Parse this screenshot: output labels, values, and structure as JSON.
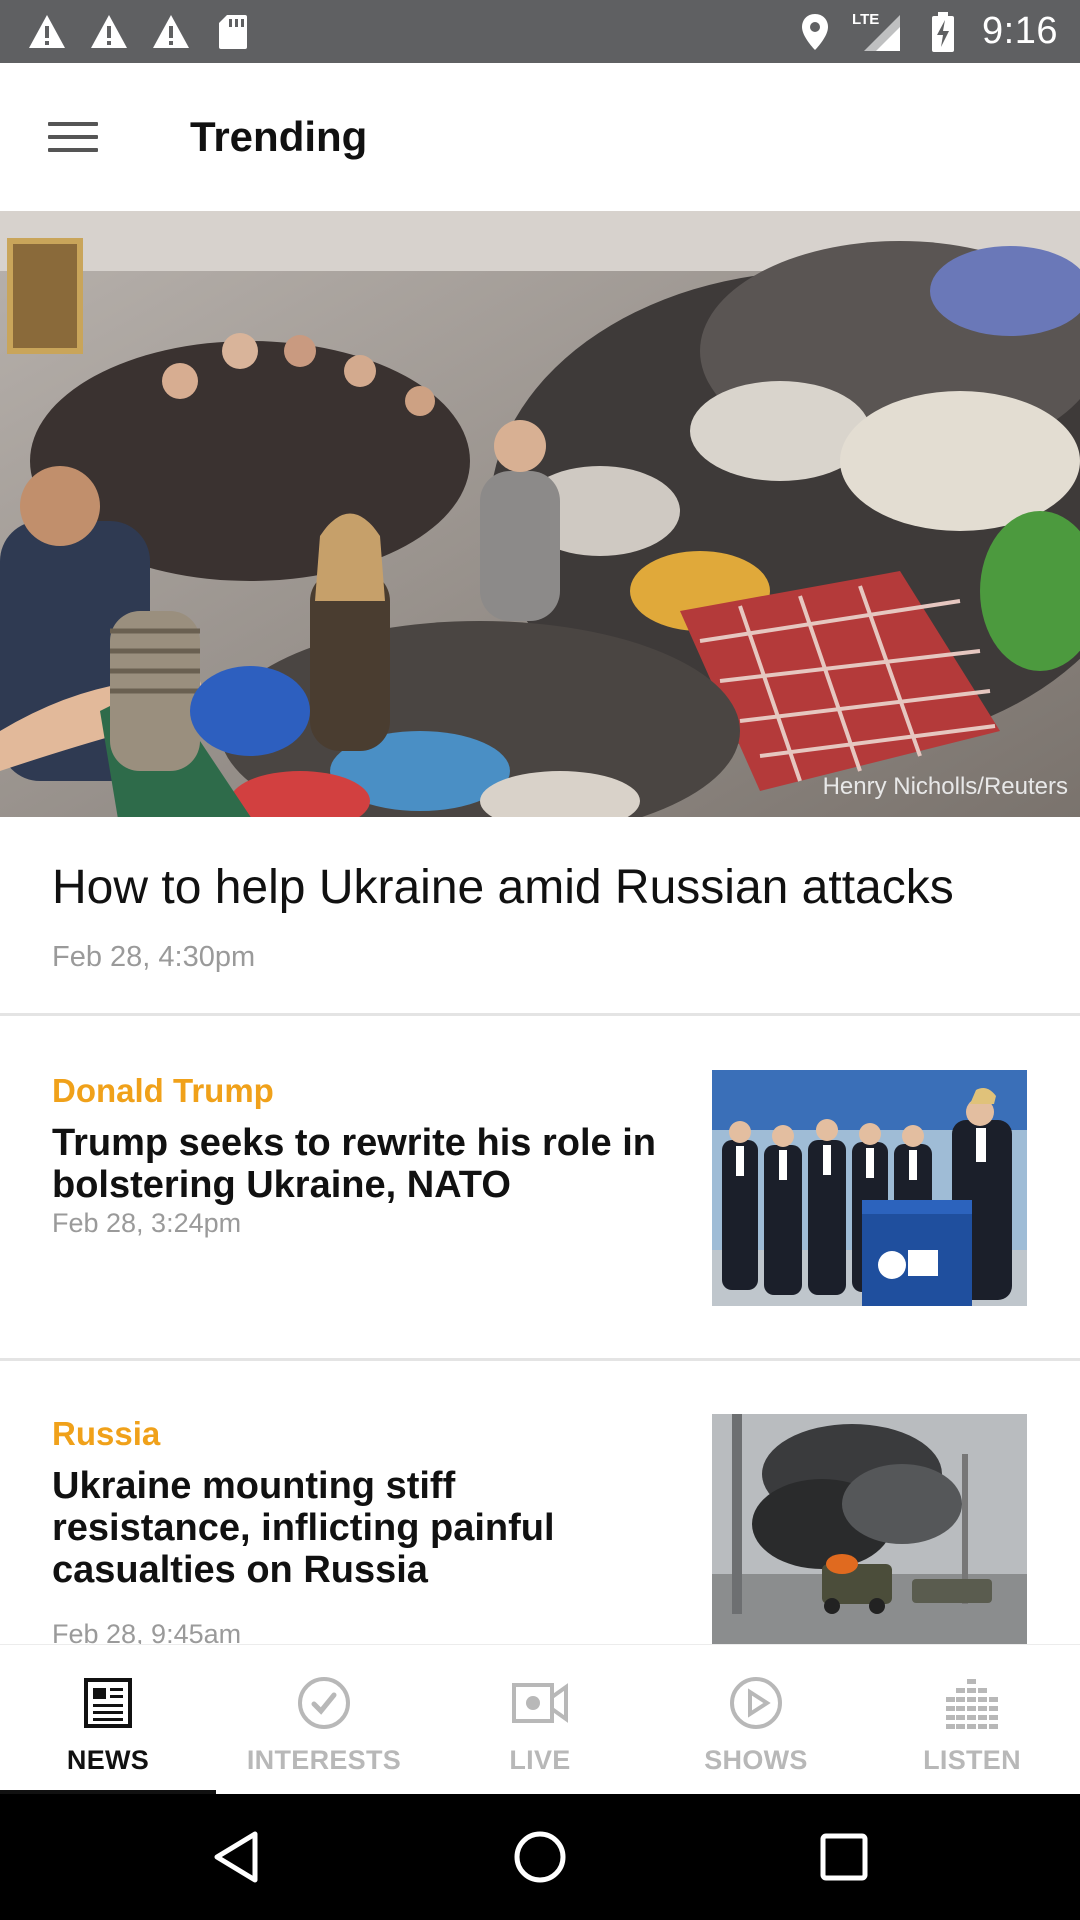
{
  "status_bar": {
    "time": "9:16",
    "network": "LTE",
    "icons_left": [
      "warning-icon",
      "warning-icon",
      "warning-icon",
      "sd-card-icon"
    ],
    "icons_right": [
      "location-icon",
      "signal-icon",
      "battery-charging-icon"
    ]
  },
  "app_bar": {
    "title": "Trending",
    "menu_icon": "hamburger-menu-icon"
  },
  "hero": {
    "credit": "Henry Nicholls/Reuters",
    "headline": "How to help Ukraine amid Russian attacks",
    "date": "Feb 28, 4:30pm"
  },
  "stories": [
    {
      "category": "Donald Trump",
      "title": "Trump seeks to rewrite his role in bolstering Ukraine, NATO",
      "date": "Feb 28, 3:24pm"
    },
    {
      "category": "Russia",
      "title": "Ukraine mounting stiff resistance, inflicting painful casualties on Russia",
      "date": "Feb 28, 9:45am"
    }
  ],
  "bottom_nav": {
    "items": [
      {
        "label": "NEWS",
        "icon": "newspaper-icon",
        "active": true
      },
      {
        "label": "INTERESTS",
        "icon": "check-circle-icon",
        "active": false
      },
      {
        "label": "LIVE",
        "icon": "video-camera-icon",
        "active": false
      },
      {
        "label": "SHOWS",
        "icon": "play-circle-icon",
        "active": false
      },
      {
        "label": "LISTEN",
        "icon": "equalizer-icon",
        "active": false
      }
    ]
  },
  "colors": {
    "status_bar": "#5f6062",
    "category_accent": "#f0a11a",
    "active_nav": "#111111",
    "inactive_nav": "#b8b8b8"
  }
}
